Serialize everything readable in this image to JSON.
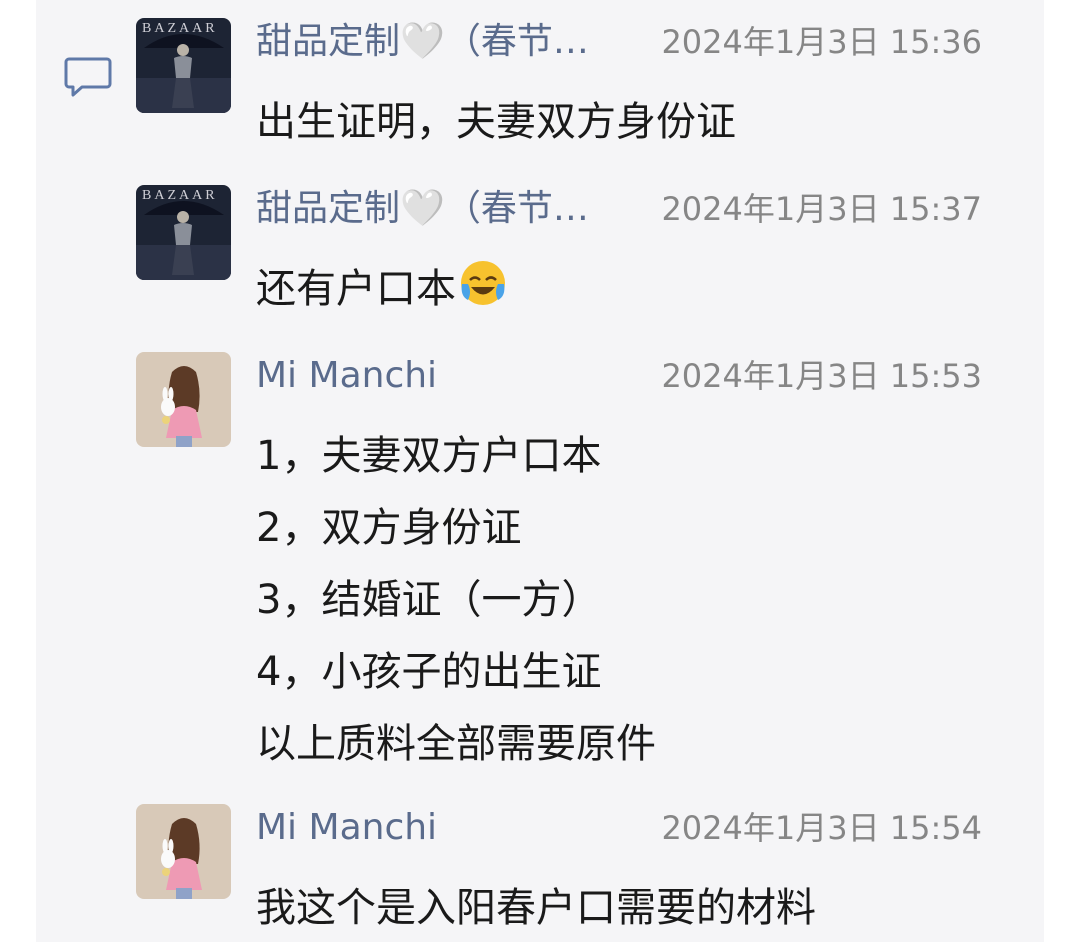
{
  "messages": [
    {
      "sender": "甜品定制🤍（春节…",
      "time": "2024年1月3日 15:36",
      "lines": [
        "出生证明，夫妻双方身份证"
      ]
    },
    {
      "sender": "甜品定制🤍（春节…",
      "time": "2024年1月3日 15:37",
      "lines": [
        "还有户口本"
      ],
      "emoji": "laughing-crying-emoji"
    },
    {
      "sender": "Mi Manchi",
      "time": "2024年1月3日 15:53",
      "lines": [
        "1，夫妻双方户口本",
        "2，双方身份证",
        "3，结婚证（一方）",
        "4，小孩子的出生证",
        "以上质料全部需要原件"
      ]
    },
    {
      "sender": "Mi Manchi",
      "time": "2024年1月3日 15:54",
      "lines": [
        "我这个是入阳春户口需要的材料"
      ]
    }
  ],
  "icons": {
    "comment": "comment-icon",
    "avatar_1": "avatar-bazaar-photo",
    "avatar_2": "avatar-girl-with-bunny"
  },
  "colors": {
    "sender": "#5a6b8c",
    "timestamp": "#868686",
    "panel_background": "#f5f5f7"
  }
}
